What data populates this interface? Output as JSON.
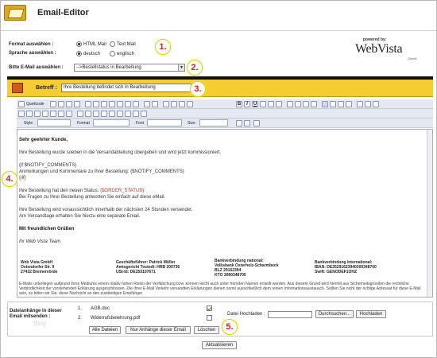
{
  "header": {
    "title": "Email-Editor"
  },
  "format": {
    "label": "Format auswählen :",
    "options": [
      "HTML Mail",
      "Text Mail"
    ],
    "selected": "HTML Mail"
  },
  "language": {
    "label": "Sprache auswählen :",
    "options": [
      "deutsch",
      "englisch"
    ],
    "selected": "deutsch"
  },
  "mail_select": {
    "label": "Bitte E-Mail auswählen :",
    "value": "-->Bestellstatus in Bearbeitung"
  },
  "brand": {
    "powered_by": "powered by:",
    "name": "WebVista",
    "suffix": "GmbH"
  },
  "callouts": [
    "1.",
    "2.",
    "3.",
    "4.",
    "5."
  ],
  "subject": {
    "label": "Betreff :",
    "value": "Ihre Bestellung befindet sich in Bearbeitung"
  },
  "toolbar": {
    "source_label": "Quellcode",
    "style_label": "Style",
    "format_label": "Format",
    "font_label": "Font",
    "size_label": "Size"
  },
  "editor": {
    "greeting": "Sehr geehrter Kunde,",
    "p1": "Ihre Bestellung wurde soeben in die Versandabteilung übergeben und wird jetzt kommissioniert.",
    "if_open": "{if $NOTIFY_COMMENTS}",
    "comments": "Anmerkungen und Kommentare zu Ihrer Bestellung: {$NOTIFY_COMMENTS}",
    "if_close": "{/if}",
    "status_prefix": "Ihre Bestellung hat den neuen Status: ",
    "status_var": "{$ORDER_STATUS}",
    "questions": "Bei Fragen zu Ihrer Bestellung antworten Sie einfach auf diese eMail.",
    "p3a": "Ihre Bestellung wird voraussichtlich innerhalb der nächsten 24 Stunden versendet.",
    "p3b": "Am Versandtage erhalten Sie hierzu eine separate Email.",
    "regards": "Mit freundlichen Grüßen",
    "team": "Ihr Web Vista Team",
    "footer": {
      "company": [
        "Web Vista GmbH",
        "Ostendorfer Str. 9",
        "27432 Bremervörde"
      ],
      "management": [
        "Geschäftsführer: Patrick Müller",
        "Amtsgericht Tostedt: HRB 200736",
        "USt-Id: DE253107671"
      ],
      "bank_national": [
        "Bankverbindung national:",
        "Volksbank Osterholz-Scharmbeck",
        "BLZ 29162394",
        "KTO 3080348700"
      ],
      "bank_international": [
        "Bankverbindung international:",
        "IBAN: DE25291623940300348700",
        "Swift: GENODEF1OHZ"
      ]
    },
    "disclaimer": "E-Mails unterliegen aufgrund ihres Mediums einem relativ hohen Risiko der Verfälschung bzw. können leicht auch unter fremden Namen erstellt werden. Aus diesem Grund wird hiermit aus Sicherheitsgründen die rechtliche Verbindlichkeit der vorstehenden Erklärung ausgeschlossen. Die Ihrer E-Mail Verkehr versandten Erklärungen dienen somit ausschließlich dem reinen Informationsaustausch. Sollten Sie nicht der richtige Adressat für diese E-Mail sein, so bitten wir Sie, diese Nachricht an den zuständigen Empfänger"
  },
  "attachments": {
    "label": "Dateianhänge in dieser Email mitsenden :",
    "watermark": "Blog",
    "files": [
      {
        "index": "1.",
        "name": "AGB.doc",
        "checked": true
      },
      {
        "index": "2.",
        "name": "Widerrufsbelehrung.pdf",
        "checked": false
      }
    ],
    "btn_all": "Alle Dateien",
    "btn_none": "Nur Anhänge dieser Email",
    "btn_delete": "Löschen",
    "upload_label": "Datei Hochladen :",
    "btn_browse": "Durchsuchen...",
    "btn_upload": "Hochladen"
  },
  "update_button": "Aktualisieren"
}
